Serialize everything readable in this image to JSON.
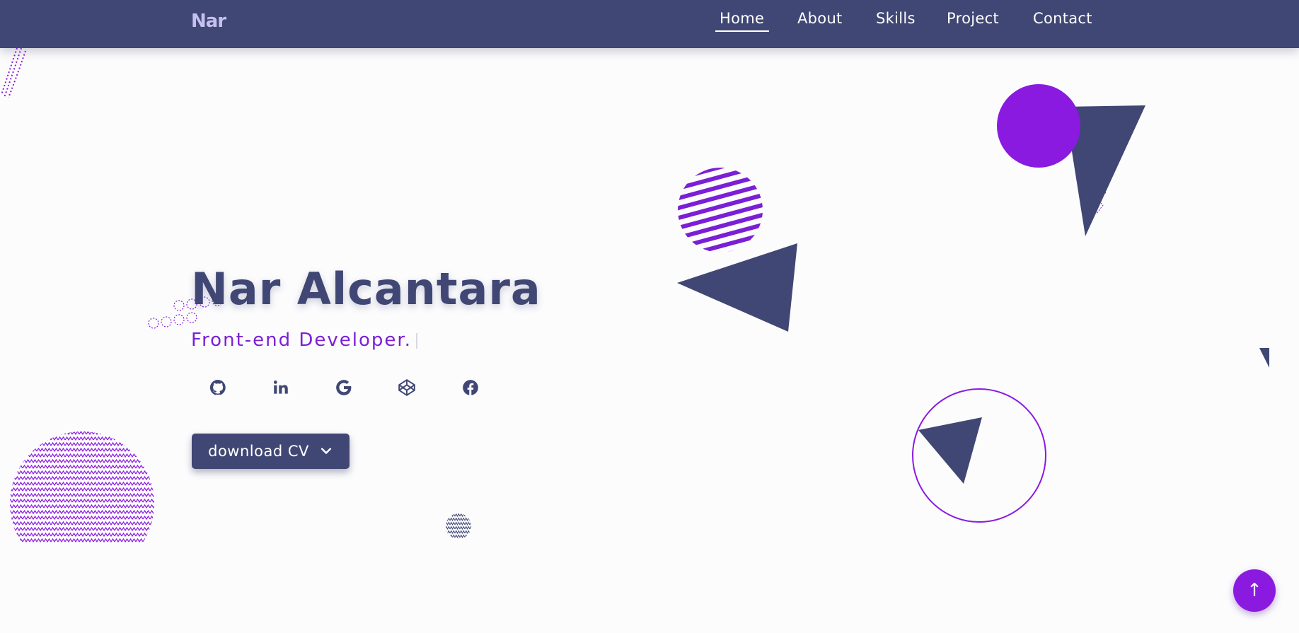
{
  "theme": {
    "navy": "#404774",
    "purple": "#8a1ae0",
    "background": "#fcfcfd"
  },
  "navbar": {
    "logo": "Nar",
    "items": [
      {
        "label": "Home",
        "active": true
      },
      {
        "label": "About",
        "active": false
      },
      {
        "label": "Skills",
        "active": false
      },
      {
        "label": "Project",
        "active": false
      },
      {
        "label": "Contact",
        "active": false
      }
    ]
  },
  "hero": {
    "name": "Nar Alcantara",
    "role": "Front-end Developer."
  },
  "social": [
    {
      "icon": "github-icon"
    },
    {
      "icon": "linkedin-icon"
    },
    {
      "icon": "google-icon"
    },
    {
      "icon": "codepen-icon"
    },
    {
      "icon": "facebook-icon"
    }
  ],
  "cv_button": {
    "label": "download CV",
    "icon": "chevron-down-icon"
  },
  "back_to_top": {
    "label": "↑"
  }
}
